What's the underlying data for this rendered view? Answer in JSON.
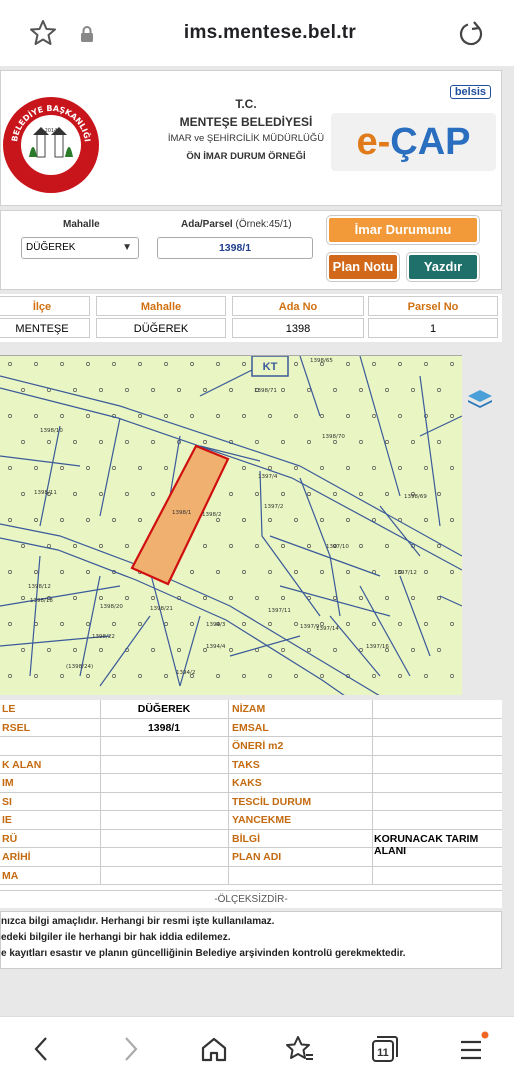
{
  "browser": {
    "url": "ims.mentese.bel.tr",
    "tab_count": "11"
  },
  "header": {
    "line1": "T.C.",
    "line2": "MENTEŞE BELEDİYESİ",
    "line3": "İMAR ve ŞEHİRCİLİK MÜDÜRLÜĞÜ",
    "line4": "ÖN İMAR DURUM ÖRNEĞİ",
    "belsis": "belsis",
    "ecap_e": "e-",
    "ecap_c": "ÇAP",
    "logo_text_top": "BELEDİYE BAŞKANLIĞI",
    "logo_text_bottom": "MENTEŞE",
    "logo_year": "2014"
  },
  "query": {
    "mahalle_label": "Mahalle",
    "mahalle_value": "DÜĞEREK",
    "ada_label": "Ada/Parsel",
    "ada_hint": "(Örnek:45/1)",
    "ada_value": "1398/1",
    "sorgula_btn": "İmar Durumunu Sorgula",
    "plan_notu_btn": "Plan Notu",
    "yazdir_btn": "Yazdır"
  },
  "summary": {
    "headers": [
      "İlçe",
      "Mahalle",
      "Ada No",
      "Parsel No"
    ],
    "values": [
      "MENTEŞE",
      "DÜĞEREK",
      "1398",
      "1"
    ]
  },
  "map": {
    "kt_label": "KT",
    "parcel_labels": [
      "1398/65",
      "1398/71",
      "1398/10",
      "1398/70",
      "1398/11",
      "1397/4",
      "1398/69",
      "1398/1",
      "1398/2",
      "1397/2",
      "1397/10",
      "1397/12",
      "1398/12",
      "1398/18",
      "1398/20",
      "1398/21",
      "1398/22",
      "(1398/24)",
      "1397/11",
      "1397/9",
      "1397/14",
      "1397/16",
      "1394/3",
      "1394/4",
      "1394/2"
    ],
    "colors": {
      "background": "#e9f5c2",
      "parcel_fill": "#f0b070",
      "parcel_border": "#d01010",
      "lines": "#3a5a9a"
    }
  },
  "details": {
    "rows": [
      {
        "left_label": "LE",
        "left_value": "DÜĞEREK",
        "right_label": "NİZAM",
        "right_value": ""
      },
      {
        "left_label": "RSEL",
        "left_value": "1398/1",
        "right_label": "EMSAL",
        "right_value": ""
      },
      {
        "left_label": "",
        "left_value": "",
        "right_label": "ÖNERİ m2",
        "right_value": ""
      },
      {
        "left_label": "K ALAN",
        "left_value": "",
        "right_label": "TAKS",
        "right_value": ""
      },
      {
        "left_label": "IM",
        "left_value": "",
        "right_label": "KAKS",
        "right_value": ""
      },
      {
        "left_label": "SI",
        "left_value": "",
        "right_label": "TESCİL DURUM",
        "right_value": ""
      },
      {
        "left_label": "IE",
        "left_value": "",
        "right_label": "YANCEKME",
        "right_value": ""
      },
      {
        "left_label": "RÜ",
        "left_value": "",
        "right_label": "BİLGİ",
        "right_value": "KORUNACAK TARIM ALANI"
      },
      {
        "left_label": "ARİHİ",
        "left_value": "",
        "right_label": "PLAN ADI",
        "right_value": ""
      },
      {
        "left_label": "MA",
        "left_value": "",
        "right_label": "",
        "right_value": ""
      }
    ],
    "scale_note": "-ÖLÇEKSİZDİR-"
  },
  "notes": [
    "nızca bilgi amaçlıdır. Herhangi bir resmi işte kullanılamaz.",
    "edeki bilgiler ile herhangi bir hak iddia edilemez.",
    "e kayıtları esastır ve planın güncelliğinin Belediye arşivinden kontrolü gerekmektedir."
  ]
}
